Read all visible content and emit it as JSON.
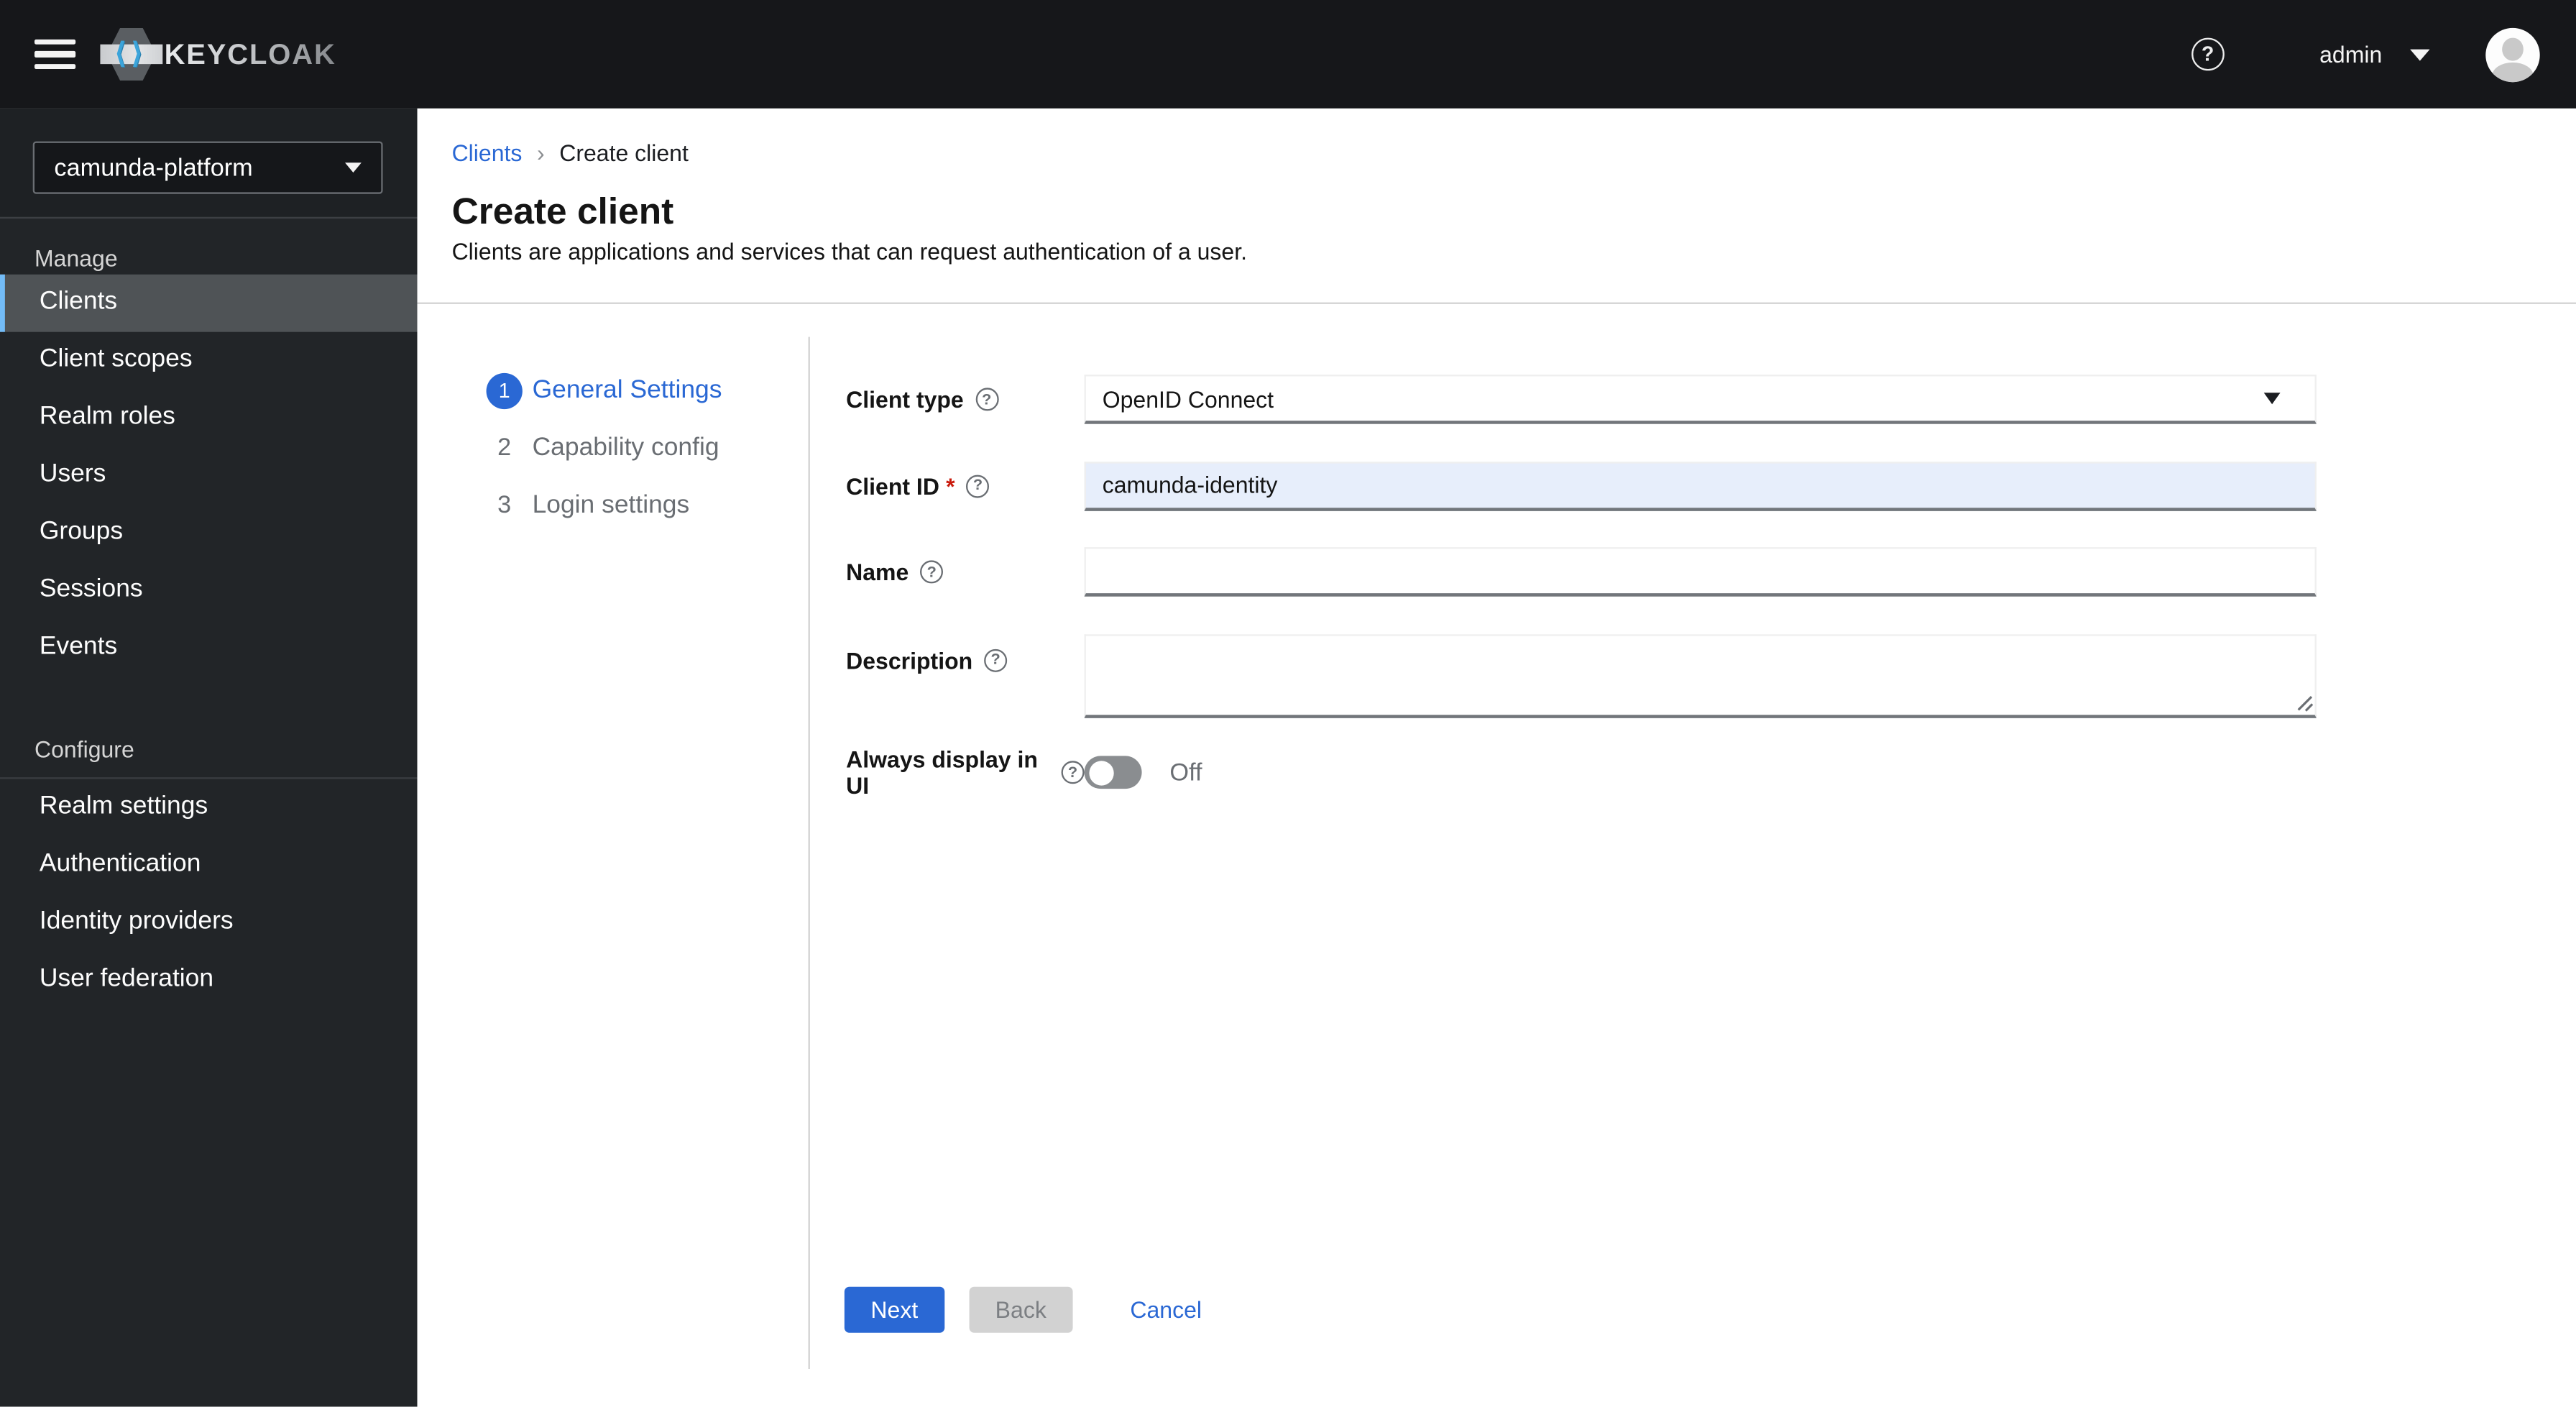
{
  "colors": {
    "accent": "#2a68d4",
    "masthead_bg": "#16171a",
    "sidebar_bg": "#222528",
    "active_nav_bg": "#4f5356",
    "active_nav_border": "#73bcf7",
    "required_asterisk": "#c9190b",
    "client_id_field_bg": "#e7eefb"
  },
  "masthead": {
    "brand": "KEYCLOAK",
    "username": "admin"
  },
  "sidebar": {
    "realm_selector": {
      "value": "camunda-platform"
    },
    "sections": [
      {
        "title": "Manage",
        "items": [
          "Clients",
          "Client scopes",
          "Realm roles",
          "Users",
          "Groups",
          "Sessions",
          "Events"
        ],
        "active_item": "Clients"
      },
      {
        "title": "Configure",
        "items": [
          "Realm settings",
          "Authentication",
          "Identity providers",
          "User federation"
        ]
      }
    ]
  },
  "breadcrumb": {
    "parent": "Clients",
    "current": "Create client"
  },
  "page": {
    "title": "Create client",
    "subtitle": "Clients are applications and services that can request authentication of a user."
  },
  "wizard": {
    "steps": [
      {
        "number": "1",
        "label": "General Settings",
        "active": true
      },
      {
        "number": "2",
        "label": "Capability config",
        "active": false
      },
      {
        "number": "3",
        "label": "Login settings",
        "active": false
      }
    ]
  },
  "form": {
    "client_type": {
      "label": "Client type",
      "value": "OpenID Connect"
    },
    "client_id": {
      "label": "Client ID",
      "required_marker": "*",
      "value": "camunda-identity"
    },
    "name": {
      "label": "Name",
      "value": ""
    },
    "description": {
      "label": "Description",
      "value": ""
    },
    "always_display_in_ui": {
      "label": "Always display in UI",
      "state": "Off"
    }
  },
  "actions": {
    "next": "Next",
    "back": "Back",
    "cancel": "Cancel"
  }
}
